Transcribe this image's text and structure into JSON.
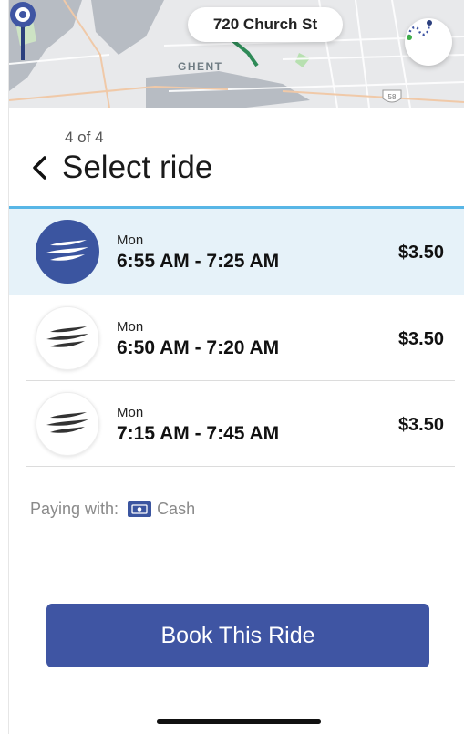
{
  "map": {
    "address": "720 Church St",
    "area_label": "GHENT",
    "route_shield": "58",
    "route_icon": "route-icon"
  },
  "header": {
    "step": "4 of 4",
    "title": "Select ride",
    "back_icon": "chevron-left-icon"
  },
  "rides": [
    {
      "day": "Mon",
      "time": "6:55 AM - 7:25 AM",
      "price": "$3.50",
      "selected": true
    },
    {
      "day": "Mon",
      "time": "6:50 AM - 7:20 AM",
      "price": "$3.50",
      "selected": false
    },
    {
      "day": "Mon",
      "time": "7:15 AM - 7:45 AM",
      "price": "$3.50",
      "selected": false
    }
  ],
  "payment": {
    "label": "Paying with:",
    "method": "Cash",
    "icon": "cash-icon"
  },
  "book_button": {
    "label": "Book This Ride"
  },
  "colors": {
    "primary": "#3f55a3",
    "selected_bg": "#e6f2f9",
    "accent_line": "#58b6e6"
  }
}
